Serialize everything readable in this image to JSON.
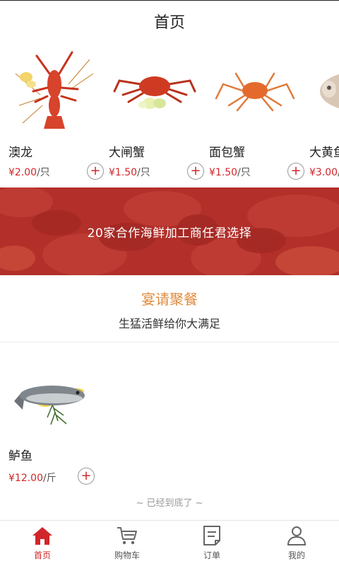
{
  "header": {
    "title": "首页"
  },
  "products_row": [
    {
      "name": "澳龙",
      "price": "¥2.00",
      "unit": "/只",
      "image_icon": "lobster-image"
    },
    {
      "name": "大闸蟹",
      "price": "¥1.50",
      "unit": "/只",
      "image_icon": "crab-image"
    },
    {
      "name": "面包蟹",
      "price": "¥1.50",
      "unit": "/只",
      "image_icon": "spider-crab-image"
    },
    {
      "name": "大黄鱼",
      "price": "¥3.00",
      "unit": "/只",
      "image_icon": "fish-image"
    }
  ],
  "banner": {
    "text": "20家合作海鲜加工商任君选择"
  },
  "promo": {
    "title": "宴请聚餐",
    "subtitle": "生猛活鲜给你大满足"
  },
  "product_list": [
    {
      "name": "鲈鱼",
      "price": "¥12.00",
      "unit": "/斤",
      "image_icon": "sea-bass-image"
    }
  ],
  "end_note": "~ 已经到底了 ~",
  "tabbar": {
    "items": [
      {
        "label": "首页",
        "icon": "home-icon",
        "active": true
      },
      {
        "label": "购物车",
        "icon": "cart-icon",
        "active": false
      },
      {
        "label": "订单",
        "icon": "order-icon",
        "active": false
      },
      {
        "label": "我的",
        "icon": "profile-icon",
        "active": false
      }
    ]
  },
  "colors": {
    "accent": "#d0262b",
    "promo": "#e08a3a",
    "banner": "#b9332e"
  }
}
